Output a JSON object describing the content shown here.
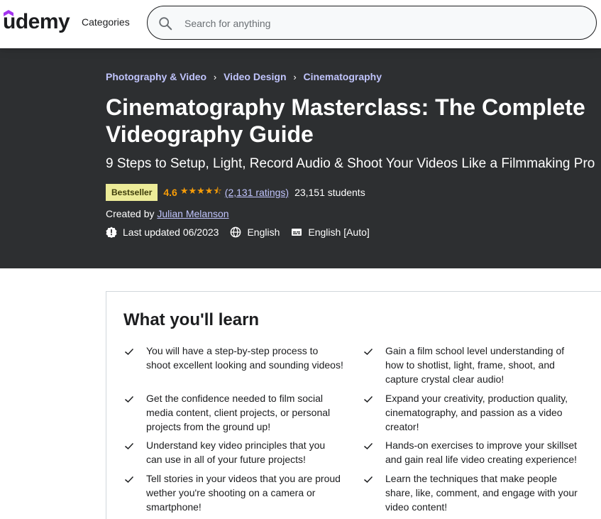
{
  "header": {
    "logo": "udemy",
    "categories_label": "Categories",
    "search_placeholder": "Search for anything"
  },
  "breadcrumb": [
    "Photography & Video",
    "Video Design",
    "Cinematography"
  ],
  "course": {
    "title": "Cinematography Masterclass: The Complete Videography Guide",
    "subtitle": "9 Steps to Setup, Light, Record Audio & Shoot Your Videos Like a Filmmaking Pro",
    "badge": "Bestseller",
    "rating": "4.6",
    "stars": "★★★★⯪",
    "rating_count": "(2,131 ratings)",
    "students": "23,151 students",
    "created_by_label": "Created by",
    "instructor": "Julian Melanson",
    "last_updated": "Last updated 06/2023",
    "language": "English",
    "captions": "English [Auto]"
  },
  "learn": {
    "heading": "What you'll learn",
    "items": [
      "You will have a step-by-step process to shoot excellent looking and sounding videos!",
      "Gain a film school level understanding of how to shotlist, light, frame, shoot, and capture crystal clear audio!",
      "Get the confidence needed to film social media content, client projects, or personal projects from the ground up!",
      "Expand your creativity, production quality, cinematography, and passion as a video creator!",
      "Understand key video principles that you can use in all of your future projects!",
      "Hands-on exercises to improve your skillset and gain real life video creating experience!",
      "Tell stories in your videos that you are proud wether you're shooting on a camera or smartphone!",
      "Learn the techniques that make people share, like, comment, and engage with your video content!"
    ]
  },
  "colors": {
    "hero_bg": "#2d2f31",
    "link_purple": "#c0c4fc",
    "rating_orange": "#f69c08",
    "badge_bg": "#eceb98",
    "logo_accent": "#a435f0"
  }
}
